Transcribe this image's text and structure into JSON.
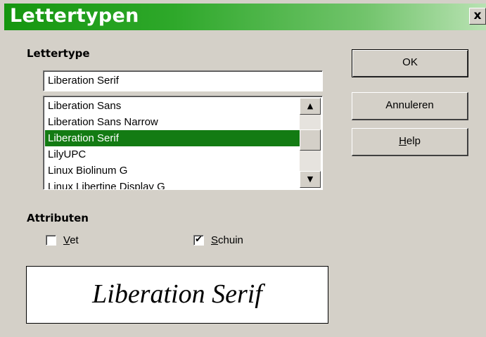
{
  "window": {
    "title": "Lettertypen",
    "close_glyph": "x"
  },
  "font_section": {
    "label": "Lettertype",
    "input_value": "Liberation Serif",
    "list_items": [
      {
        "label": "Liberation Sans",
        "selected": false
      },
      {
        "label": "Liberation Sans Narrow",
        "selected": false
      },
      {
        "label": "Liberation Serif",
        "selected": true
      },
      {
        "label": "LilyUPC",
        "selected": false
      },
      {
        "label": "Linux Biolinum G",
        "selected": false
      },
      {
        "label": "Linux Libertine Display G",
        "selected": false
      }
    ],
    "scroll_up_glyph": "▲",
    "scroll_down_glyph": "▼"
  },
  "buttons": {
    "ok": "OK",
    "cancel": "Annuleren",
    "help_mnemonic": "H",
    "help_rest": "elp"
  },
  "attributes": {
    "label": "Attributen",
    "bold": {
      "mnemonic": "V",
      "rest": "et",
      "checked": false
    },
    "italic": {
      "mnemonic": "S",
      "rest": "chuin",
      "checked": true
    },
    "check_glyph": "✔"
  },
  "preview": {
    "text": "Liberation Serif"
  },
  "colors": {
    "title_gradient_start": "#15960f",
    "selection": "#137b13",
    "dialog_bg": "#d4d0c8"
  }
}
